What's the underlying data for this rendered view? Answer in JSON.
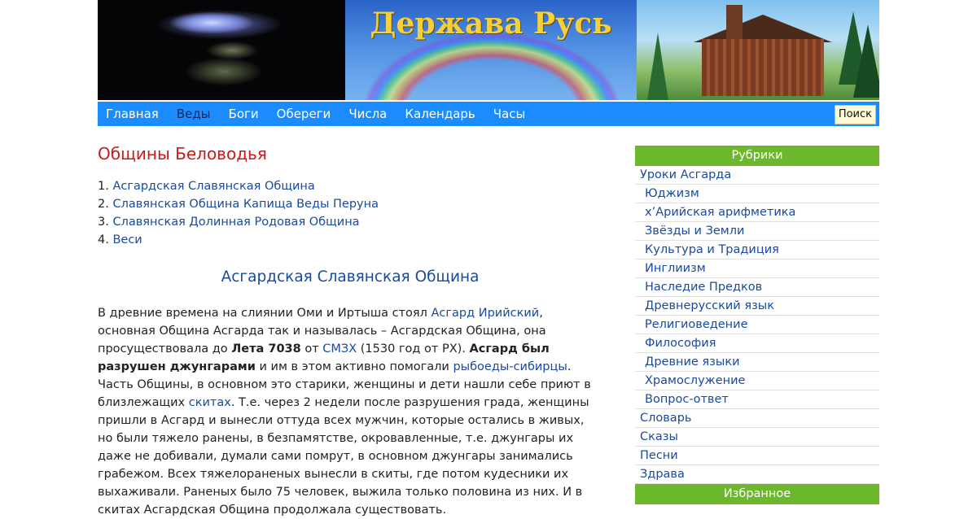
{
  "site": {
    "title": "Держава Русь"
  },
  "nav": {
    "items": [
      {
        "label": "Главная"
      },
      {
        "label": "Веды"
      },
      {
        "label": "Боги"
      },
      {
        "label": "Обереги"
      },
      {
        "label": "Числа"
      },
      {
        "label": "Календарь"
      },
      {
        "label": "Часы"
      }
    ],
    "active_index": 1,
    "search_label": "Поиск"
  },
  "content": {
    "page_title": "Общины Беловодья",
    "toc": [
      {
        "num": "1.",
        "label": "Асгардская Славянская Община"
      },
      {
        "num": "2.",
        "label": "Славянская Община Капища Веды Перуна"
      },
      {
        "num": "3.",
        "label": "Славянская Долинная Родовая Община"
      },
      {
        "num": "4.",
        "label": "Веси"
      }
    ],
    "section_title": "Асгардская Славянская Община",
    "paragraph": {
      "t1": "В древние времена на слиянии Оми и Иртыша стоял ",
      "link1": "Асгард Ирийский",
      "t2": ", основная Община Асгарда так и называлась – Асгардская Община, она просуществовала до ",
      "b1": "Лета 7038",
      "t3": " от ",
      "link2": "СМЗХ",
      "t4": " (1530 год от РХ). ",
      "b2": "Асгард был разрушен джунгарами",
      "t5": " и им в этом активно помогали ",
      "link3": "рыбоеды-сибирцы",
      "t6": ". Часть Общины, в основном это старики, женщины и дети нашли себе приют в близлежащих ",
      "link4": "скитах",
      "t7": ". Т.е. через 2 недели после разрушения града, женщины пришли в Асгард и вынесли оттуда всех мужчин, которые остались в живых, но были тяжело ранены, в безпамятстве, окровавленные, т.е. джунгары их даже не добивали, думали сами помрут, в основном джунгары занимались грабежом. Всех тяжелораненых вынесли в скиты, где потом кудесники их выхаживали. Раненых было 75 человек, выжила только половина из них. И в скитах Асгардская Община продолжала существовать."
    }
  },
  "sidebar": {
    "rubrics_title": "Рубрики",
    "items": [
      {
        "label": "Уроки Асгарда",
        "level": "top"
      },
      {
        "label": "Юджизм",
        "level": "sub"
      },
      {
        "label": "х’Арийская арифметика",
        "level": "sub"
      },
      {
        "label": "Звёзды и Земли",
        "level": "sub"
      },
      {
        "label": "Культура и Традиция",
        "level": "sub"
      },
      {
        "label": "Инглиизм",
        "level": "sub"
      },
      {
        "label": "Наследие Предков",
        "level": "sub"
      },
      {
        "label": "Древнерусский язык",
        "level": "sub"
      },
      {
        "label": "Религиоведение",
        "level": "sub"
      },
      {
        "label": "Философия",
        "level": "sub"
      },
      {
        "label": "Древние языки",
        "level": "sub"
      },
      {
        "label": "Храмослужение",
        "level": "sub"
      },
      {
        "label": "Вопрос-ответ",
        "level": "sub"
      },
      {
        "label": "Словарь",
        "level": "top"
      },
      {
        "label": "Сказы",
        "level": "top"
      },
      {
        "label": "Песни",
        "level": "top"
      },
      {
        "label": "Здрава",
        "level": "top"
      }
    ],
    "favorites_title": "Избранное"
  },
  "colors": {
    "nav_bg": "#1a8cff",
    "sidebar_head_bg": "#6cb72c",
    "title_red": "#cc1a1a",
    "link_blue": "#1a4a9e",
    "banner_title": "#f7cf3a"
  }
}
